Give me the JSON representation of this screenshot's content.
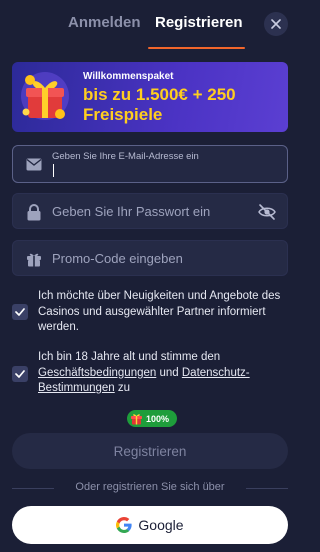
{
  "tabs": {
    "login_label": "Anmelden",
    "register_label": "Registrieren",
    "active": "register"
  },
  "close_icon": "close-icon",
  "banner": {
    "small_text": "Willkommenspaket",
    "big_text": "bis zu 1.500€ + 250 Freispiele",
    "icon": "gift-chest-icon"
  },
  "form": {
    "email": {
      "icon": "envelope-icon",
      "placeholder": "Geben Sie Ihre E-Mail-Adresse ein",
      "value": ""
    },
    "password": {
      "icon": "lock-icon",
      "placeholder": "Geben Sie Ihr Passwort ein",
      "toggle_icon": "eye-off-icon"
    },
    "promo": {
      "icon": "gift-icon",
      "placeholder": "Promo-Code eingeben"
    }
  },
  "checkboxes": {
    "newsletter": {
      "checked": true,
      "text": "Ich möchte über Neuigkeiten und Angebote des Casinos und ausgewählter Partner informiert werden."
    },
    "terms": {
      "checked": true,
      "text_before": "Ich bin 18 Jahre alt und stimme den ",
      "link_terms": "Geschäftsbedingungen",
      "text_mid": " und ",
      "link_privacy": "Datenschutz-Bestimmungen",
      "text_after": " zu"
    }
  },
  "badge": {
    "percent": "100%",
    "color": "#1e9d3b"
  },
  "register_button": "Registrieren",
  "divider_text": "Oder registrieren Sie sich über",
  "google_button": "Google",
  "colors": {
    "background": "#1b1f36",
    "accent": "#f2662b",
    "banner_text": "#ffce1f",
    "input_bg": "#252a45"
  }
}
